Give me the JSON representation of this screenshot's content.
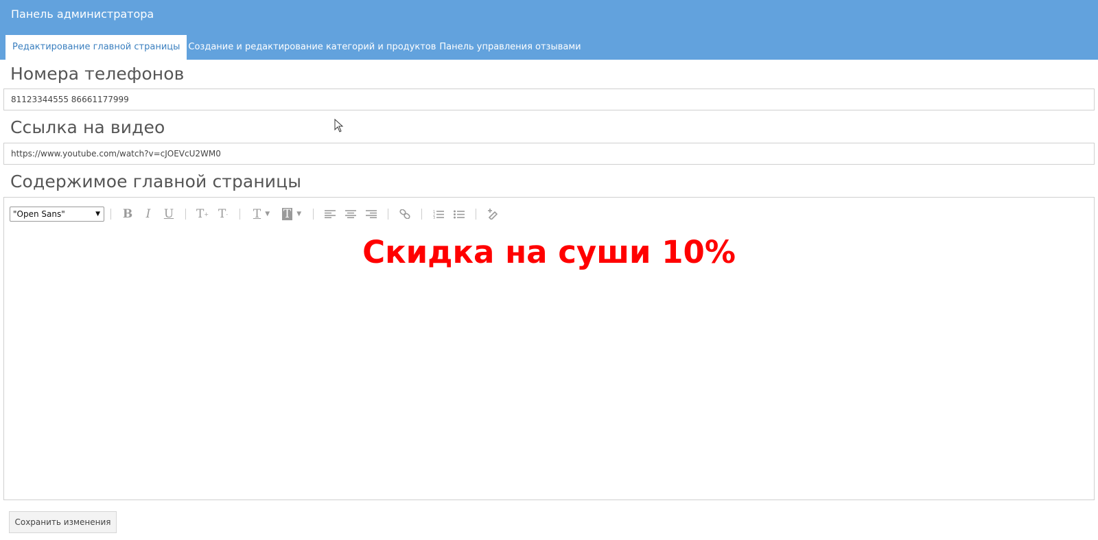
{
  "header": {
    "title": "Панель администратора",
    "tabs": [
      {
        "label": "Редактирование главной страницы",
        "active": true
      },
      {
        "label": "Создание и редактирование категорий и продуктов",
        "active": false
      },
      {
        "label": "Панель управления отзывами",
        "active": false
      }
    ]
  },
  "phones": {
    "heading": "Номера телефонов",
    "value": "81123344555 86661177999"
  },
  "video": {
    "heading": "Ссылка на видео",
    "value": "https://www.youtube.com/watch?v=cJOEVcU2WM0"
  },
  "content": {
    "heading": "Содержимое главной страницы",
    "font_family_value": "\"Open Sans\"",
    "body_text": "Скидка на суши 10%",
    "body_text_color": "#ff0000"
  },
  "actions": {
    "save_label": "Сохранить изменения"
  },
  "colors": {
    "header_bg": "#62a2dd",
    "active_tab_text": "#3a7fbf"
  },
  "toolbar_icons": [
    "bold-icon",
    "italic-icon",
    "underline-icon",
    "superscript-icon",
    "subscript-icon",
    "text-color-icon",
    "background-color-icon",
    "align-left-icon",
    "align-center-icon",
    "align-right-icon",
    "link-icon",
    "ordered-list-icon",
    "unordered-list-icon",
    "clear-format-icon"
  ]
}
